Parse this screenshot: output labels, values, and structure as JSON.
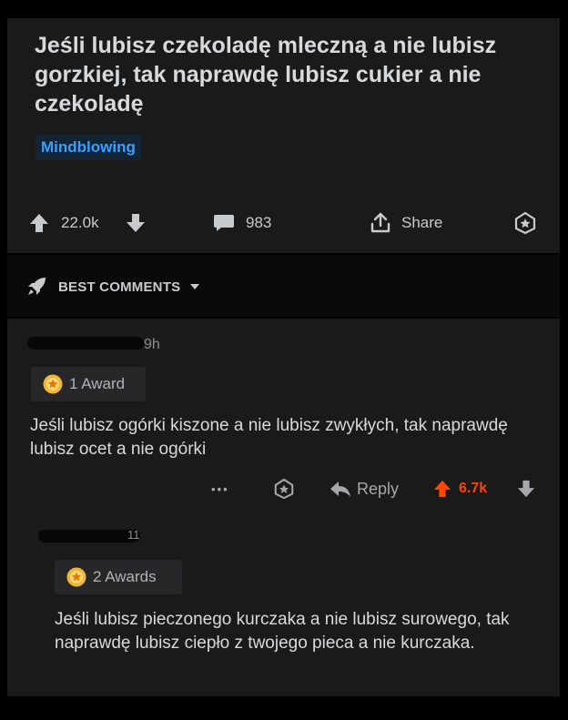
{
  "post": {
    "title": "Jeśli lubisz czekoladę mleczną a nie lubisz gorzkiej, tak naprawdę lubisz cukier a nie czekoladę",
    "flair": "Mindblowing",
    "score": "22.0k",
    "comments_count": "983",
    "share_label": "Share"
  },
  "sort": {
    "label": "BEST COMMENTS"
  },
  "comments": [
    {
      "meta_fragment": "9h",
      "award": "1 Award",
      "body": "Jeśli lubisz ogórki kiszone a nie lubisz zwykłych, tak naprawdę lubisz ocet a nie ogórki",
      "more_label": "•••",
      "reply_label": "Reply",
      "score": "6.7k"
    },
    {
      "meta_fragment": "11",
      "award": "2 Awards",
      "body": "Jeśli lubisz pieczonego kurczaka a nie lubisz surowego, tak naprawdę lubisz ciepło z twojego pieca a nie kurczaka."
    }
  ],
  "colors": {
    "accent_upvote": "#ff4500",
    "flair_text": "#3aa0ff",
    "background": "#1a1a1b"
  }
}
